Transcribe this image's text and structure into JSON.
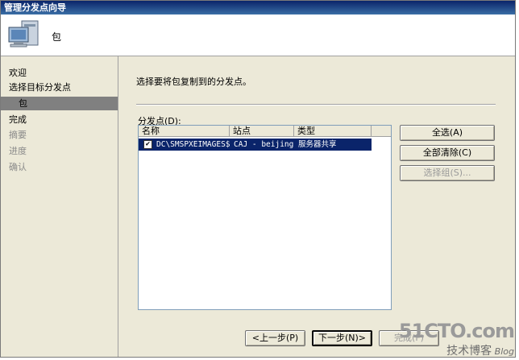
{
  "window": {
    "title": "管理分发点向导"
  },
  "header": {
    "title": "包",
    "icon": "computer-icon"
  },
  "nav": {
    "items": [
      {
        "label": "欢迎",
        "state": "normal"
      },
      {
        "label": "选择目标分发点",
        "state": "normal"
      },
      {
        "label": "包",
        "state": "selected"
      },
      {
        "label": "完成",
        "state": "normal"
      },
      {
        "label": "摘要",
        "state": "disabled"
      },
      {
        "label": "进度",
        "state": "disabled"
      },
      {
        "label": "确认",
        "state": "disabled"
      }
    ]
  },
  "main": {
    "instruction": "选择要将包复制到的分发点。",
    "list_label": "分发点(D):",
    "columns": [
      "名称",
      "站点",
      "类型"
    ],
    "rows": [
      {
        "checked": true,
        "name": "DC\\SMSPXEIMAGES$",
        "site": "CAJ - beijing",
        "type": "服务器共享"
      }
    ],
    "select_all": "全选(A)",
    "clear_all": "全部清除(C)",
    "select_group": "选择组(S)..."
  },
  "footer": {
    "prev": "<上一步(P)",
    "next": "下一步(N)>",
    "finish": "完成(F)"
  },
  "watermark": {
    "line1": "51CTO.com",
    "line2": "技术博客",
    "line3": "Blog"
  }
}
